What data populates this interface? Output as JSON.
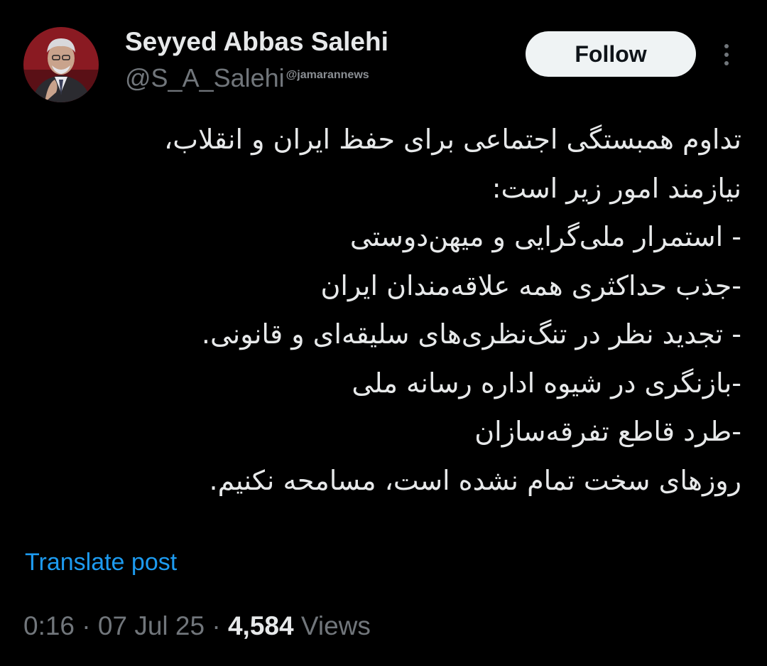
{
  "author": {
    "display_name": "Seyyed Abbas Salehi",
    "handle": "@S_A_Salehi",
    "avatar": "avatar-photo"
  },
  "watermark": "@jamarannews",
  "actions": {
    "follow_label": "Follow",
    "more_icon": "more-vertical-icon"
  },
  "post": {
    "lines": [
      "تداوم همبستگی اجتماعی برای حفظ ایران و انقلاب،",
      "نیازمند امور زیر است:",
      "- استمرار ملی‌گرایی و میهن‌دوستی",
      "-جذب حداکثری همه علاقه‌مندان ایران",
      "- تجدید نظر در تنگ‌نظری‌های سلیقه‌ای و  قانونی.",
      "-بازنگری در شیوه اداره رسانه ملی",
      "-طرد قاطع تفرقه‌سازان",
      "روزهای سخت تمام نشده است، مسامحه نکنیم."
    ]
  },
  "translate_label": "Translate post",
  "meta": {
    "time": "0:16",
    "date": "07 Jul 25",
    "views_count": "4,584",
    "views_label": "Views",
    "separator": "·"
  },
  "colors": {
    "background": "#000000",
    "text_primary": "#e7e9ea",
    "text_secondary": "#71767b",
    "link": "#1d9bf0",
    "button_bg": "#eff3f4",
    "button_text": "#0f1419"
  }
}
